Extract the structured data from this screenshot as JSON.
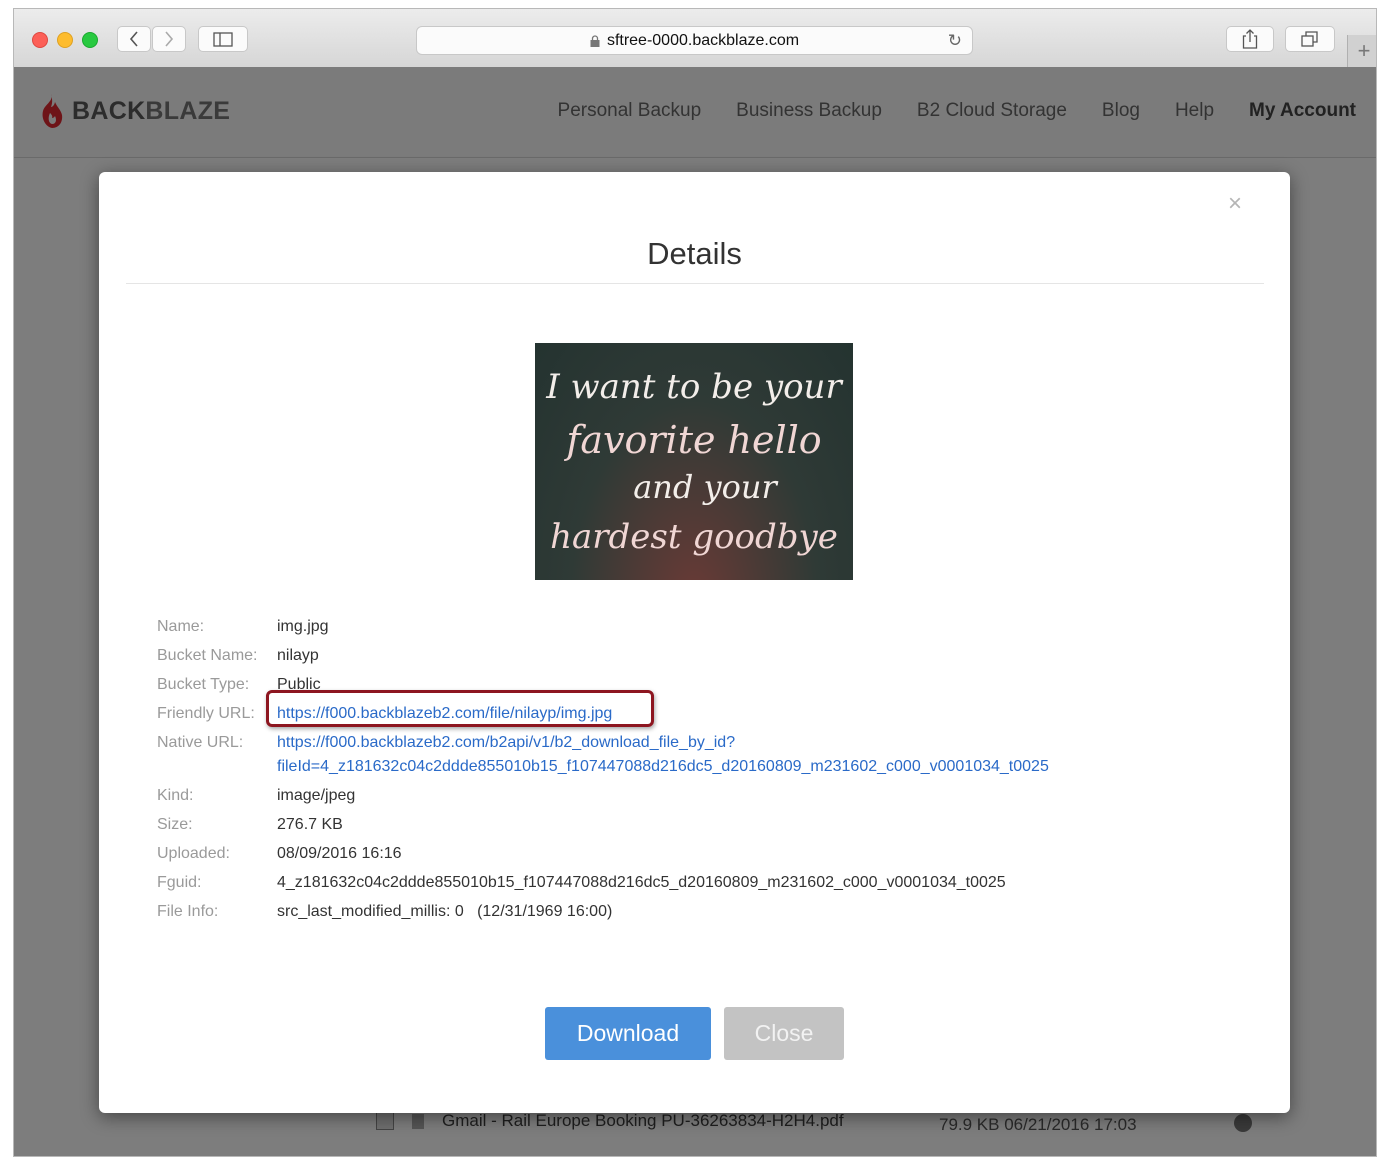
{
  "browser": {
    "url": "sftree-0000.backblaze.com",
    "new_tab_label": "+"
  },
  "site": {
    "logo_text_1": "BACK",
    "logo_text_2": "BLAZE",
    "nav": [
      "Personal Backup",
      "Business Backup",
      "B2 Cloud Storage",
      "Blog",
      "Help",
      "My Account"
    ]
  },
  "modal": {
    "title": "Details",
    "close_symbol": "×",
    "image_text": [
      "I want to be your",
      "favorite hello",
      "and your",
      "hardest goodbye"
    ],
    "fields": [
      {
        "label": "Name:",
        "value": "img.jpg"
      },
      {
        "label": "Bucket Name:",
        "value": "nilayp"
      },
      {
        "label": "Bucket Type:",
        "value": "Public"
      },
      {
        "label": "Friendly URL:",
        "value": "https://f000.backblazeb2.com/file/nilayp/img.jpg"
      },
      {
        "label": "Native URL:",
        "value_line1": "https://f000.backblazeb2.com/b2api/v1/b2_download_file_by_id?",
        "value_line2": "fileId=4_z181632c04c2ddde855010b15_f107447088d216dc5_d20160809_m231602_c000_v0001034_t0025"
      },
      {
        "label": "Kind:",
        "value": "image/jpeg"
      },
      {
        "label": "Size:",
        "value": "276.7 KB"
      },
      {
        "label": "Uploaded:",
        "value": "08/09/2016 16:16"
      },
      {
        "label": "Fguid:",
        "value": "4_z181632c04c2ddde855010b15_f107447088d216dc5_d20160809_m231602_c000_v0001034_t0025"
      },
      {
        "label": "File Info:",
        "value": "src_last_modified_millis: 0   (12/31/1969 16:00)"
      }
    ],
    "download_label": "Download",
    "close_label": "Close"
  },
  "background_row": {
    "filename": "Gmail - Rail Europe Booking PU-36263834-H2H4.pdf",
    "meta": "79.9 KB  06/21/2016 17:03"
  },
  "colors": {
    "link": "#2a6ac8",
    "highlight_box": "#8d1620",
    "download_button": "#4a90db",
    "close_button": "#c3c3c3",
    "logo_flame": "#a3161d"
  }
}
